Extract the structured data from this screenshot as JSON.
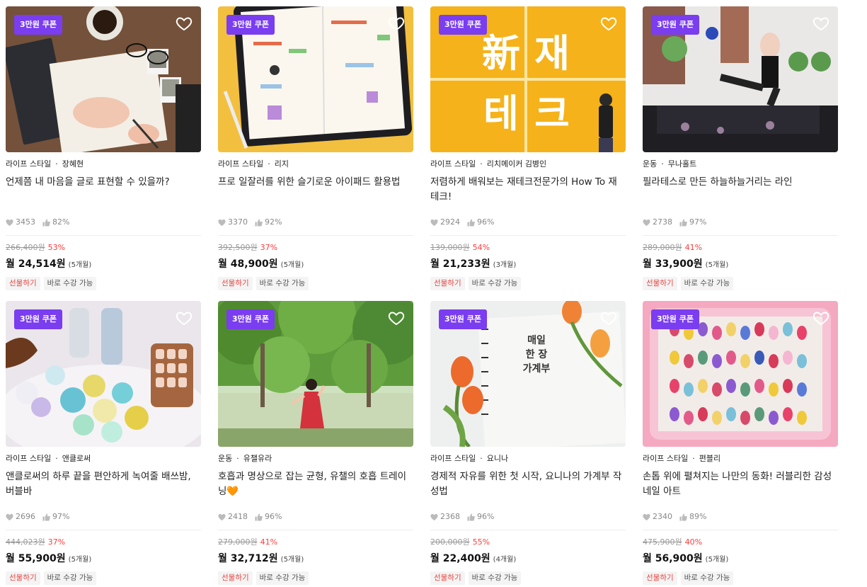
{
  "colors": {
    "coupon_bg": "#7a3df0",
    "discount": "#ff3b3b",
    "gift_tag": "#e8433e"
  },
  "icons": {
    "heart": "heart-outline-icon",
    "like": "heart-small-icon",
    "thumb": "thumbs-up-icon"
  },
  "cards": [
    {
      "coupon": "3만원 쿠폰",
      "category": "라이프 스타일",
      "creator": "장혜현",
      "title": "언제쯤 내 마음을 글로 표현할 수 있을까?",
      "likes": "3453",
      "rating": "82%",
      "orig_price": "266,400원",
      "discount": "53%",
      "monthly": "월 24,514원",
      "months": "(5개월)",
      "tag_gift": "선물하기",
      "tag_now": "바로 수강 가능"
    },
    {
      "coupon": "3만원 쿠폰",
      "category": "라이프 스타일",
      "creator": "리지",
      "title": "프로 일잘러를 위한 슬기로운 아이패드 활용법",
      "likes": "3370",
      "rating": "92%",
      "orig_price": "392,500원",
      "discount": "37%",
      "monthly": "월 48,900원",
      "months": "(5개월)",
      "tag_gift": "선물하기",
      "tag_now": "바로 수강 가능"
    },
    {
      "coupon": "3만원 쿠폰",
      "category": "라이프 스타일",
      "creator": "리치메이커 김병인",
      "title": "저렴하게 배워보는 재테크전문가의 How To 재테크!",
      "likes": "2924",
      "rating": "96%",
      "orig_price": "139,000원",
      "discount": "54%",
      "monthly": "월 21,233원",
      "months": "(3개월)",
      "tag_gift": "선물하기",
      "tag_now": "바로 수강 가능",
      "image_text": [
        "新",
        "재",
        "테",
        "크"
      ]
    },
    {
      "coupon": "3만원 쿠폰",
      "category": "운동",
      "creator": "무나홀트",
      "title": "필라테스로 만든 하늘하늘거리는 라인",
      "likes": "2738",
      "rating": "97%",
      "orig_price": "289,000원",
      "discount": "41%",
      "monthly": "월 33,900원",
      "months": "(5개월)",
      "tag_gift": "선물하기",
      "tag_now": "바로 수강 가능"
    },
    {
      "coupon": "3만원 쿠폰",
      "category": "라이프 스타일",
      "creator": "앤클로써",
      "title": "앤클로써의 하루 끝을 편안하게 녹여줄 배쓰밤, 버블바",
      "likes": "2696",
      "rating": "97%",
      "orig_price": "444,023원",
      "discount": "37%",
      "monthly": "월 55,900원",
      "months": "(5개월)",
      "tag_gift": "선물하기",
      "tag_now": "바로 수강 가능"
    },
    {
      "coupon": "3만원 쿠폰",
      "category": "운동",
      "creator": "유챌유라",
      "title": "호흡과 명상으로 잡는 균형, 유챌의 호흡 트레이닝🧡",
      "likes": "2418",
      "rating": "96%",
      "orig_price": "279,000원",
      "discount": "41%",
      "monthly": "월 32,712원",
      "months": "(5개월)",
      "tag_gift": "선물하기",
      "tag_now": "바로 수강 가능"
    },
    {
      "coupon": "3만원 쿠폰",
      "category": "라이프 스타일",
      "creator": "요니나",
      "title": "경제적 자유를 위한 첫 시작, 요니나의 가계부 작성법",
      "likes": "2368",
      "rating": "96%",
      "orig_price": "200,000원",
      "discount": "55%",
      "monthly": "월 22,400원",
      "months": "(4개월)",
      "tag_gift": "선물하기",
      "tag_now": "바로 수강 가능",
      "image_text": [
        "매일",
        "한 장",
        "가계부"
      ]
    },
    {
      "coupon": "3만원 쿠폰",
      "category": "라이프 스타일",
      "creator": "편블리",
      "title": "손톱 위에 펼쳐지는 나만의 동화! 러블리한 감성 네일 아트",
      "likes": "2340",
      "rating": "89%",
      "orig_price": "475,900원",
      "discount": "40%",
      "monthly": "월 56,900원",
      "months": "(5개월)",
      "tag_gift": "선물하기",
      "tag_now": "바로 수강 가능"
    }
  ]
}
